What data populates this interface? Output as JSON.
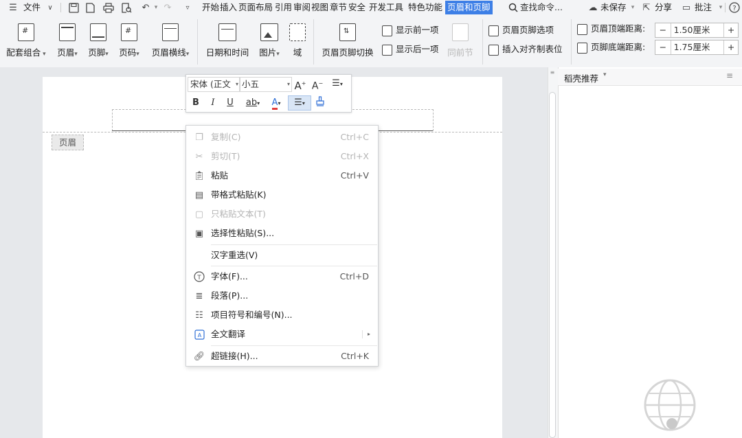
{
  "menubar": {
    "file_label": "文件",
    "tabs": [
      "开始",
      "插入",
      "页面布局",
      "引用",
      "审阅",
      "视图",
      "章节",
      "安全",
      "开发工具",
      "特色功能"
    ],
    "active_tab": "页眉和页脚",
    "search_placeholder": "查找命令...",
    "unsaved_label": "未保存",
    "share_label": "分享",
    "comment_label": "批注"
  },
  "ribbon": {
    "groups": {
      "combo": "配套组合",
      "header": "页眉",
      "footer": "页脚",
      "page_number": "页码",
      "header_line": "页眉横线",
      "datetime": "日期和时间",
      "picture": "图片",
      "field": "域",
      "switch": "页眉页脚切换",
      "show_prev": "显示前一项",
      "show_next": "显示后一项",
      "same_as_prev": "同前节",
      "options": "页眉页脚选项",
      "insert_tab": "插入对齐制表位"
    },
    "header_top_label": "页眉顶端距离:",
    "header_top_value": "1.50厘米",
    "footer_bottom_label": "页脚底端距离:",
    "footer_bottom_value": "1.75厘米"
  },
  "document": {
    "header_tag": "页眉"
  },
  "right_pane": {
    "title": "稻壳推荐"
  },
  "mini_toolbar": {
    "font_name": "宋体 (正文",
    "font_size": "小五"
  },
  "context_menu": [
    {
      "label": "复制(C)",
      "shortcut": "Ctrl+C",
      "disabled": true,
      "icon": "copy-icon"
    },
    {
      "label": "剪切(T)",
      "shortcut": "Ctrl+X",
      "disabled": true,
      "icon": "scissors-icon"
    },
    {
      "label": "粘贴",
      "shortcut": "Ctrl+V",
      "disabled": false,
      "icon": "paste-icon"
    },
    {
      "label": "带格式粘贴(K)",
      "shortcut": "",
      "disabled": false,
      "icon": "paste-format-icon"
    },
    {
      "label": "只粘贴文本(T)",
      "shortcut": "",
      "disabled": true,
      "icon": "paste-text-icon"
    },
    {
      "label": "选择性粘贴(S)...",
      "shortcut": "",
      "disabled": false,
      "icon": "paste-special-icon"
    },
    {
      "label": "汉字重选(V)",
      "shortcut": "",
      "disabled": false,
      "icon": ""
    },
    {
      "label": "字体(F)...",
      "shortcut": "Ctrl+D",
      "disabled": false,
      "icon": "font-icon"
    },
    {
      "label": "段落(P)...",
      "shortcut": "",
      "disabled": false,
      "icon": "paragraph-icon"
    },
    {
      "label": "项目符号和编号(N)...",
      "shortcut": "",
      "disabled": false,
      "icon": "bullets-icon"
    },
    {
      "label": "全文翻译",
      "shortcut": "",
      "disabled": false,
      "icon": "translate-icon"
    },
    {
      "label": "超链接(H)...",
      "shortcut": "Ctrl+K",
      "disabled": false,
      "icon": "link-icon"
    }
  ],
  "colors": {
    "accent": "#3d7fe6",
    "font_color_bar": "#e23b3b",
    "highlight": "#2f6fd6"
  }
}
